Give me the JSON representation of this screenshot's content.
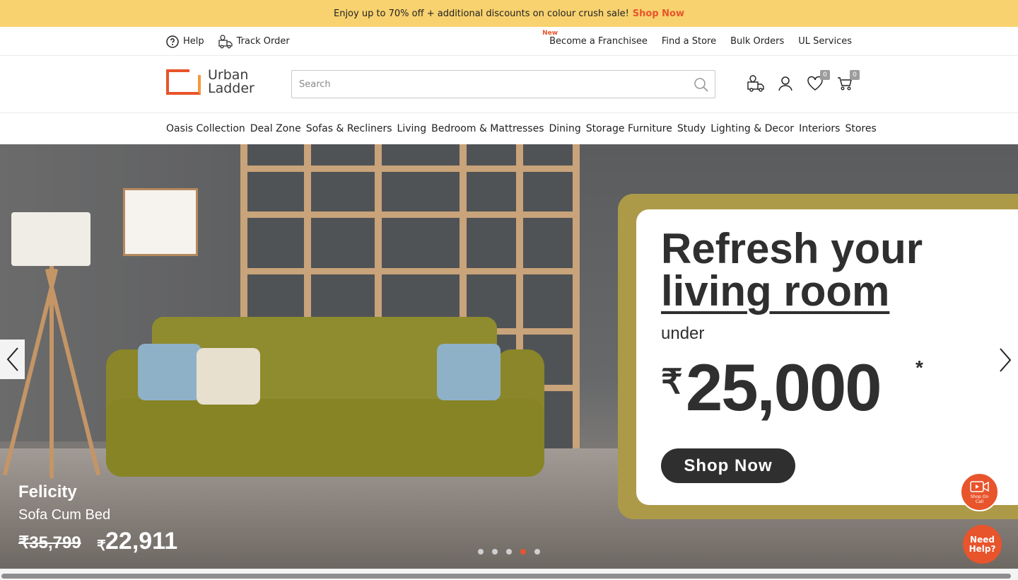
{
  "promo_banner": {
    "text": "Enjoy up to 70% off + additional discounts on colour crush sale!",
    "cta": "Shop Now"
  },
  "utility_nav": {
    "help": "Help",
    "track_order": "Track Order",
    "new_tag": "New",
    "links": [
      "Become a Franchisee",
      "Find a Store",
      "Bulk Orders",
      "UL Services"
    ]
  },
  "header": {
    "logo_line1": "Urban",
    "logo_line2": "Ladder",
    "search_placeholder": "Search",
    "wishlist_count": "0",
    "cart_count": "0"
  },
  "main_nav": [
    "Oasis Collection",
    "Deal Zone",
    "Sofas & Recliners",
    "Living",
    "Bedroom & Mattresses",
    "Dining",
    "Storage Furniture",
    "Study",
    "Lighting & Decor",
    "Interiors",
    "Stores"
  ],
  "hero": {
    "headline_line1": "Refresh your",
    "headline_line2": "living room",
    "under": "under",
    "currency": "₹",
    "amount": "25,000",
    "asterisk": "*",
    "cta": "Shop Now",
    "product_name": "Felicity",
    "product_type": "Sofa Cum Bed",
    "old_price": "₹35,799",
    "new_price_symbol": "₹",
    "new_price": "22,911",
    "slides_total": 5,
    "active_slide": 4
  },
  "floating": {
    "shop_on_call": "Shop On Call",
    "need_help": "Need Help?"
  },
  "colors": {
    "promo_bg": "#f8d26f",
    "accent": "#e8542b",
    "card_border": "#ad9a48",
    "dark": "#2f2f2f"
  }
}
